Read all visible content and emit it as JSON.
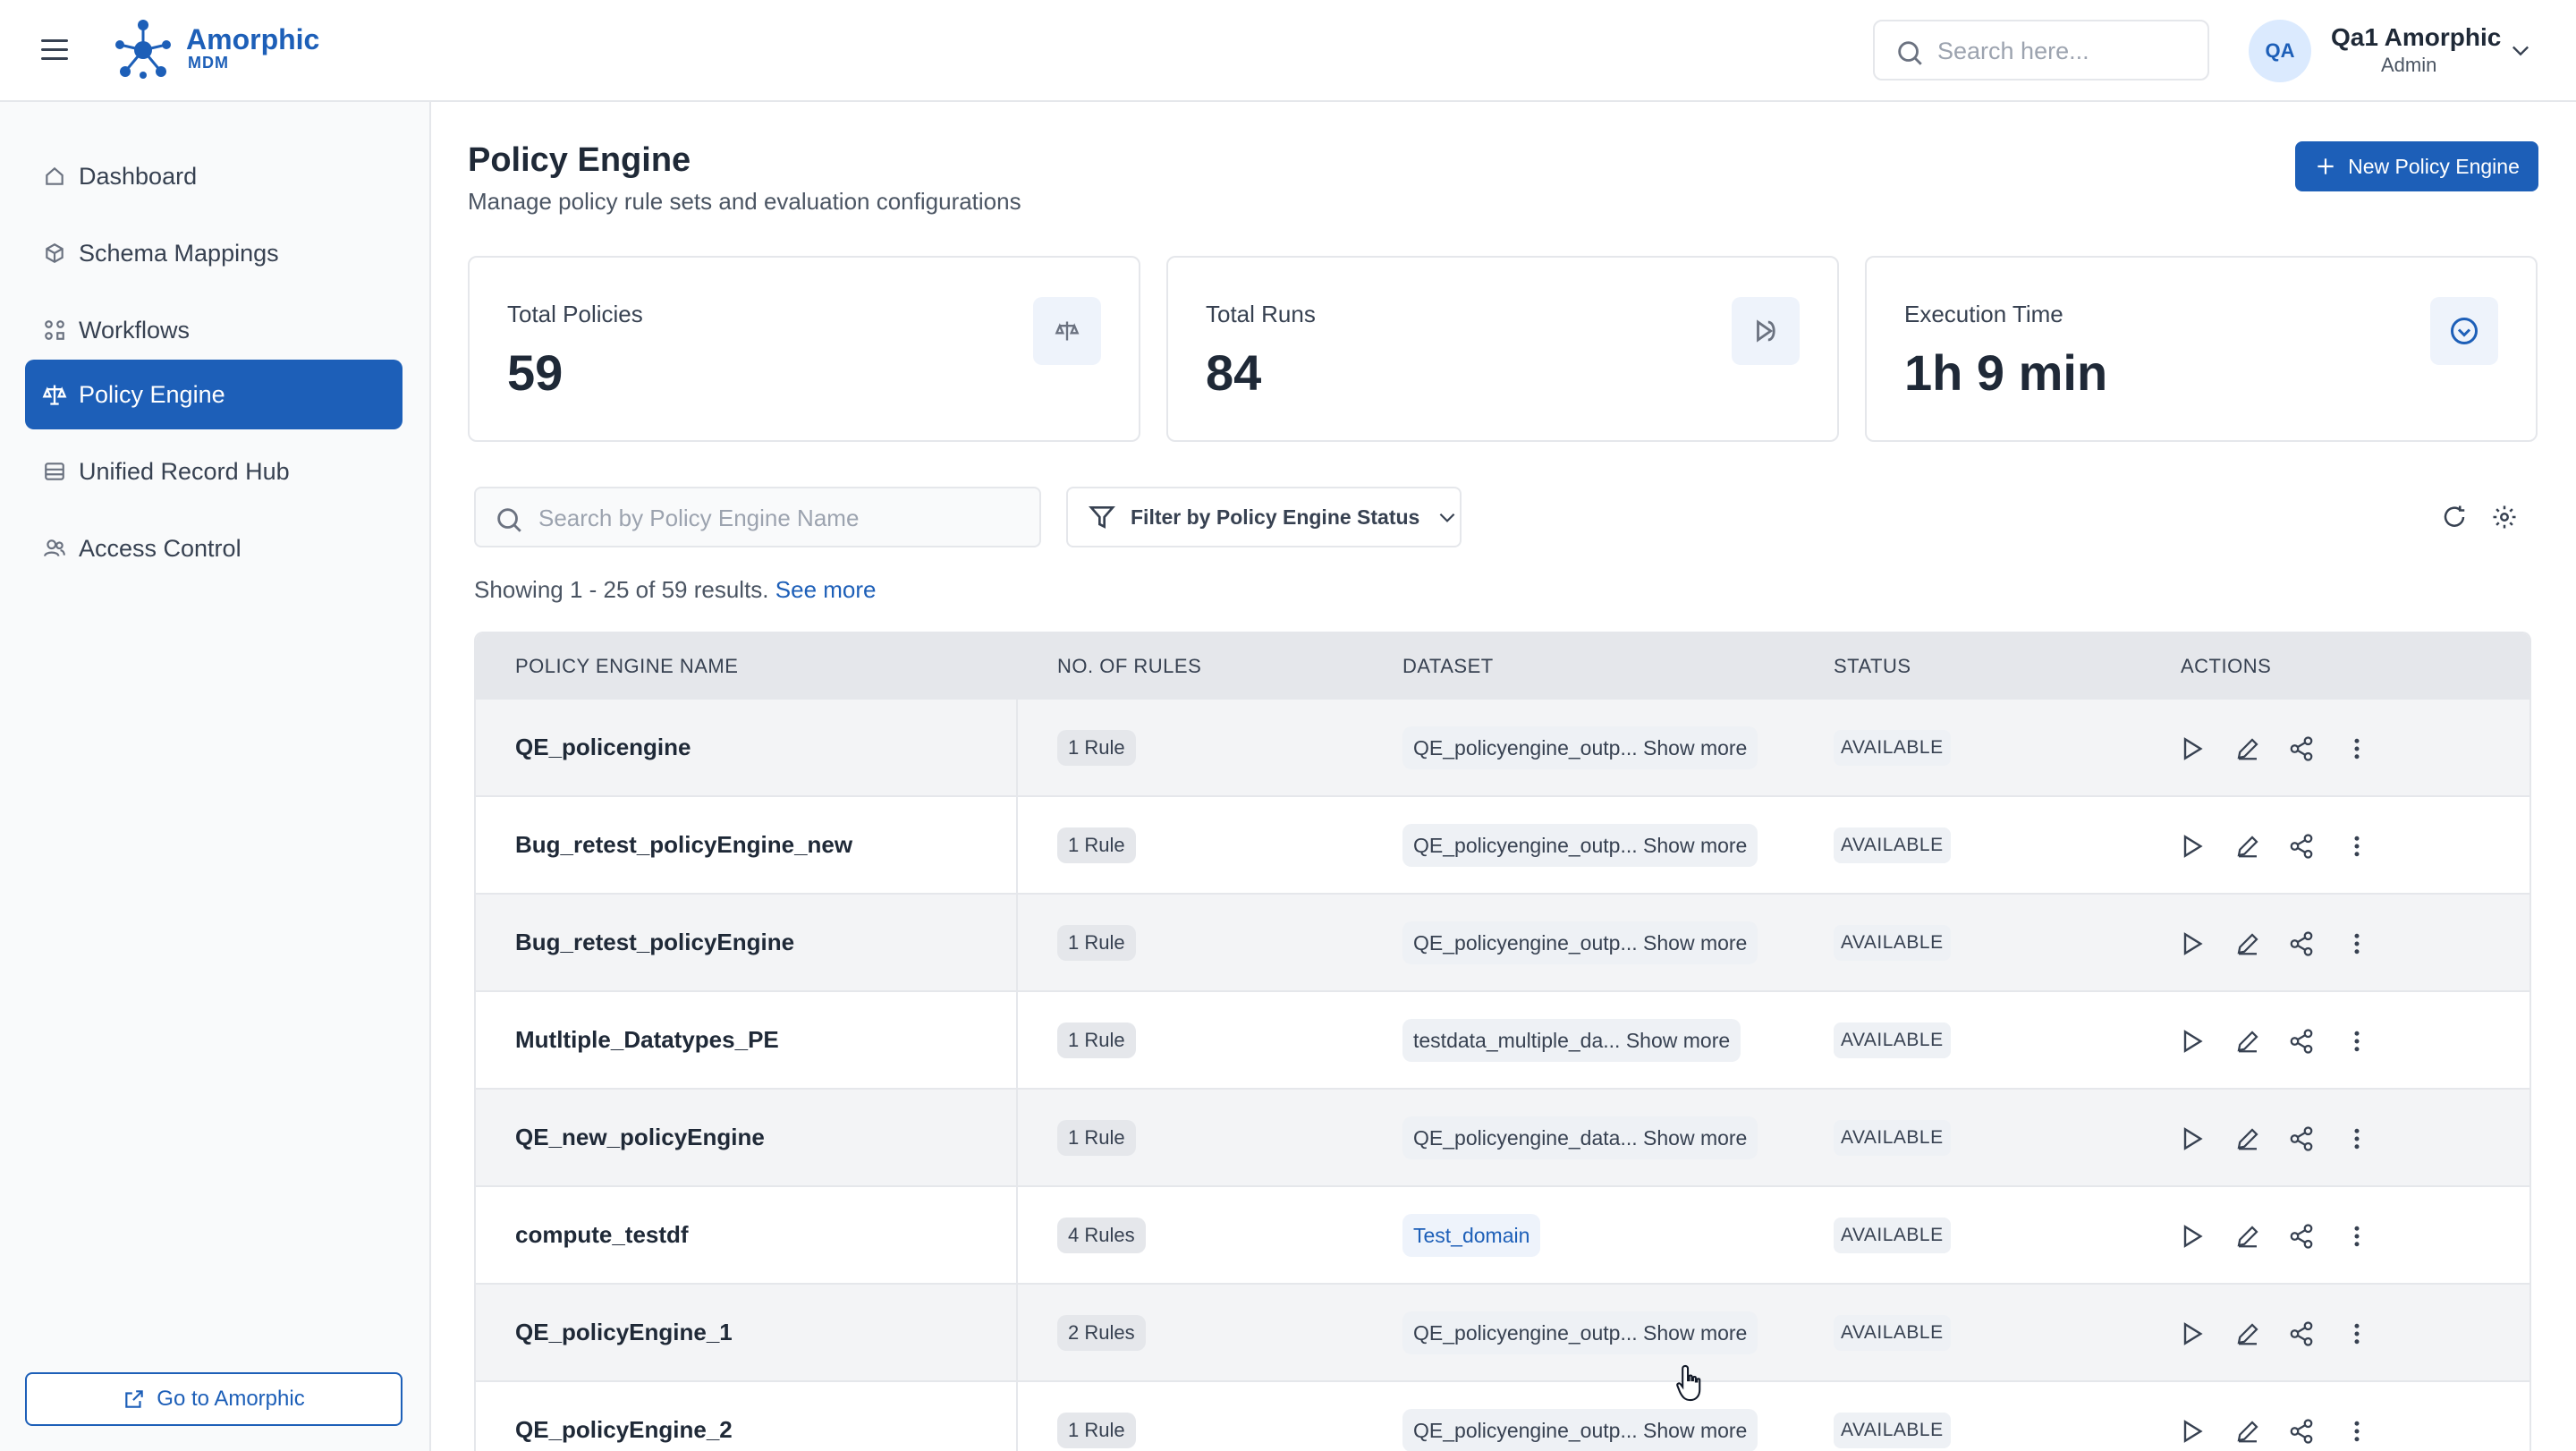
{
  "brand": {
    "name": "Amorphic",
    "sub": "MDM"
  },
  "header": {
    "search_placeholder": "Search here...",
    "user_initials": "QA",
    "user_name": "Qa1 Amorphic",
    "user_role": "Admin"
  },
  "sidebar": {
    "items": [
      {
        "label": "Dashboard",
        "icon": "home-icon",
        "active": false
      },
      {
        "label": "Schema Mappings",
        "icon": "cube-icon",
        "active": false
      },
      {
        "label": "Workflows",
        "icon": "workflow-icon",
        "active": false
      },
      {
        "label": "Policy Engine",
        "icon": "scale-icon",
        "active": true
      },
      {
        "label": "Unified Record Hub",
        "icon": "database-icon",
        "active": false
      },
      {
        "label": "Access Control",
        "icon": "users-icon",
        "active": false
      }
    ],
    "go_to_label": "Go to Amorphic"
  },
  "page": {
    "title": "Policy Engine",
    "subtitle": "Manage policy rule sets and evaluation configurations",
    "new_button_label": "New Policy Engine"
  },
  "stats": [
    {
      "label": "Total Policies",
      "value": "59",
      "icon": "scale-icon"
    },
    {
      "label": "Total Runs",
      "value": "84",
      "icon": "run-icon"
    },
    {
      "label": "Execution Time",
      "value": "1h 9 min",
      "icon": "clock-icon"
    }
  ],
  "filters": {
    "search_placeholder": "Search by Policy Engine Name",
    "status_filter_label": "Filter by Policy Engine Status"
  },
  "results": {
    "text": "Showing 1 - 25 of 59 results.",
    "see_more": "See more"
  },
  "table": {
    "columns": [
      "POLICY ENGINE NAME",
      "NO. OF RULES",
      "DATASET",
      "STATUS",
      "ACTIONS"
    ],
    "rows": [
      {
        "name": "QE_policengine",
        "rules": "1 Rule",
        "dataset": "QE_policyengine_outp...",
        "show_more": "Show more",
        "status": "AVAILABLE"
      },
      {
        "name": "Bug_retest_policyEngine_new",
        "rules": "1 Rule",
        "dataset": "QE_policyengine_outp...",
        "show_more": "Show more",
        "status": "AVAILABLE"
      },
      {
        "name": "Bug_retest_policyEngine",
        "rules": "1 Rule",
        "dataset": "QE_policyengine_outp...",
        "show_more": "Show more",
        "status": "AVAILABLE"
      },
      {
        "name": "Mutltiple_Datatypes_PE",
        "rules": "1 Rule",
        "dataset": "testdata_multiple_da...",
        "show_more": "Show more",
        "status": "AVAILABLE"
      },
      {
        "name": "QE_new_policyEngine",
        "rules": "1 Rule",
        "dataset": "QE_policyengine_data...",
        "show_more": "Show more",
        "status": "AVAILABLE"
      },
      {
        "name": "compute_testdf",
        "rules": "4 Rules",
        "dataset": "Test_domain",
        "show_more": "",
        "status": "AVAILABLE"
      },
      {
        "name": "QE_policyEngine_1",
        "rules": "2 Rules",
        "dataset": "QE_policyengine_outp...",
        "show_more": "Show more",
        "status": "AVAILABLE"
      },
      {
        "name": "QE_policyEngine_2",
        "rules": "1 Rule",
        "dataset": "QE_policyengine_outp...",
        "show_more": "Show more",
        "status": "AVAILABLE"
      }
    ]
  },
  "colors": {
    "primary": "#1d5fb8",
    "header_bg": "#e5e7eb",
    "row_alt": "#f3f4f6"
  }
}
